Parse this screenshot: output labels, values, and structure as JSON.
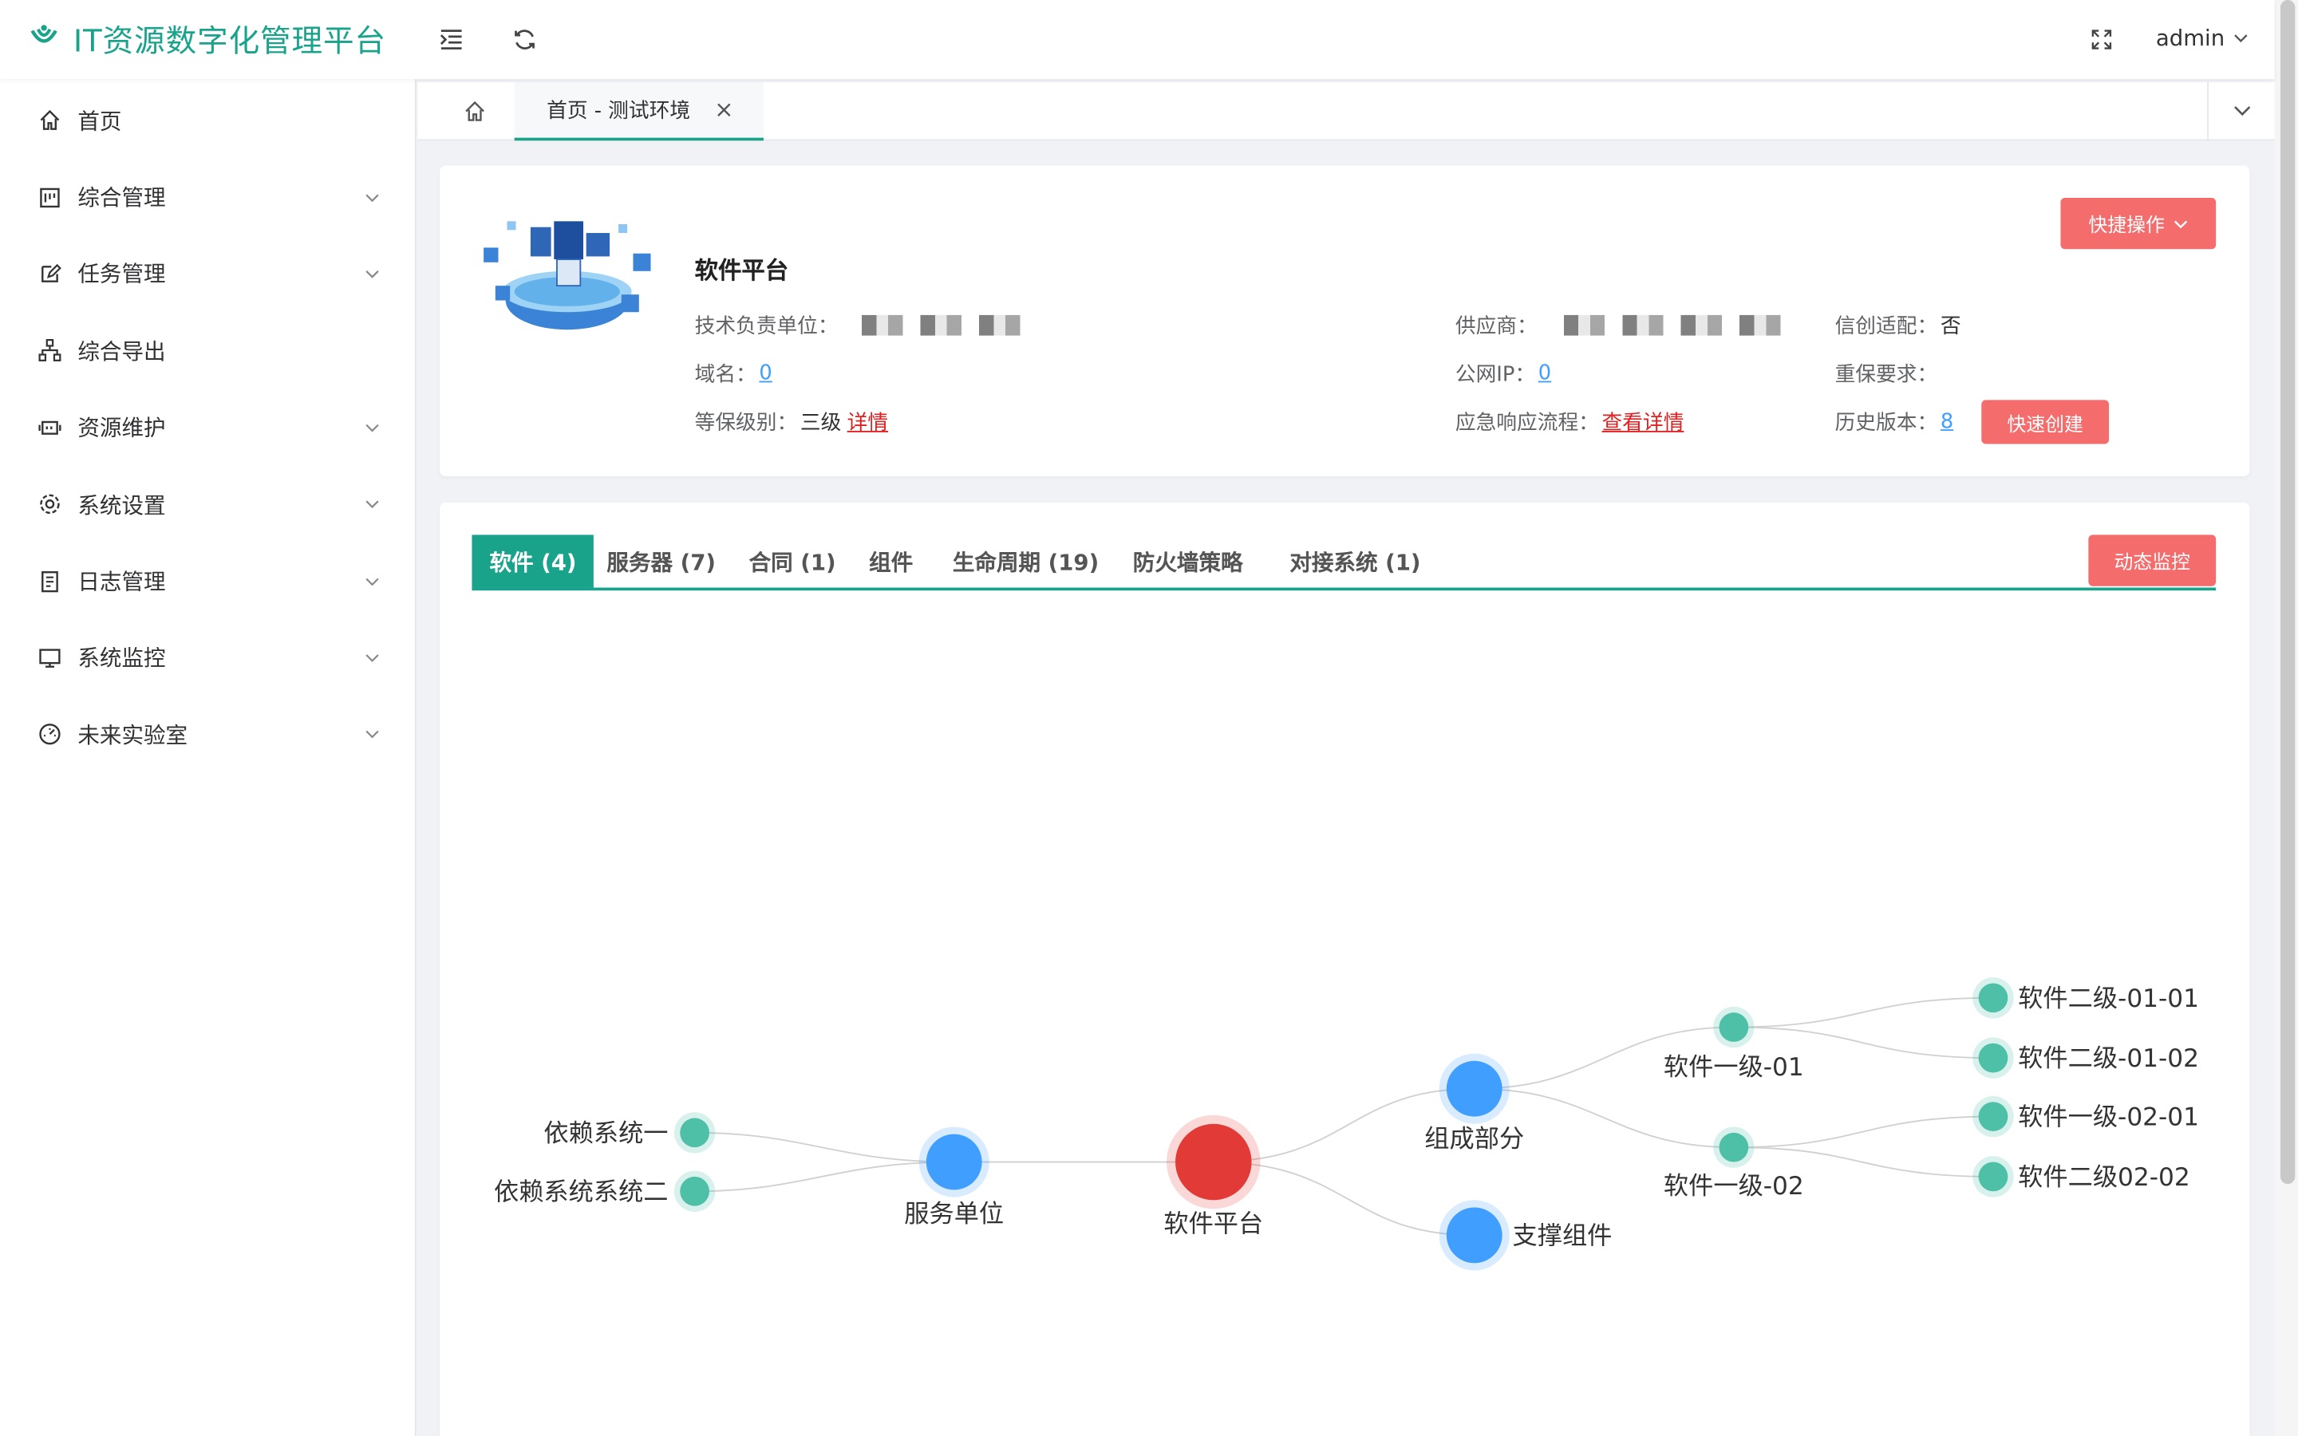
{
  "app": {
    "title": "IT资源数字化管理平台",
    "user": "admin",
    "brand_color": "#1aa38b",
    "accent_red": "#f56c6c"
  },
  "sidebar": {
    "items": [
      {
        "label": "首页",
        "icon": "home-icon",
        "expandable": false
      },
      {
        "label": "综合管理",
        "icon": "dashboard-icon",
        "expandable": true
      },
      {
        "label": "任务管理",
        "icon": "edit-icon",
        "expandable": true
      },
      {
        "label": "综合导出",
        "icon": "sitemap-icon",
        "expandable": false
      },
      {
        "label": "资源维护",
        "icon": "server-icon",
        "expandable": true
      },
      {
        "label": "系统设置",
        "icon": "gear-icon",
        "expandable": true
      },
      {
        "label": "日志管理",
        "icon": "document-icon",
        "expandable": true
      },
      {
        "label": "系统监控",
        "icon": "monitor-icon",
        "expandable": true
      },
      {
        "label": "未来实验室",
        "icon": "gauge-icon",
        "expandable": true
      }
    ]
  },
  "tabs": {
    "active_label": "首页 - 测试环境"
  },
  "info": {
    "name": "软件平台",
    "quick_ops": "快捷操作",
    "quick_create": "快速创建",
    "tech_unit_label": "技术负责单位：",
    "domain_label": "域名：",
    "domain_value": "0",
    "level_label": "等保级别：",
    "level_value": "三级",
    "level_link": "详情",
    "supplier_label": "供应商：",
    "public_ip_label": "公网IP：",
    "public_ip_value": "0",
    "emergency_label": "应急响应流程：",
    "emergency_link": "查看详情",
    "xinchuang_label": "信创适配：",
    "xinchuang_value": "否",
    "protect_label": "重保要求：",
    "history_label": "历史版本：",
    "history_value": "8"
  },
  "content_tabs": {
    "items": [
      "软件 (4)",
      "服务器 (7)",
      "合同 (1)",
      "组件",
      "生命周期 (19)",
      "防火墙策略",
      "对接系统 (1)"
    ],
    "active_index": 0,
    "monitor_button": "动态监控"
  },
  "graph": {
    "nodes": {
      "dep1": "依赖系统一",
      "dep2": "依赖系统系统二",
      "service": "服务单位",
      "center": "软件平台",
      "compose": "组成部分",
      "support": "支撑组件",
      "l1_01": "软件一级-01",
      "l1_02": "软件一级-02",
      "l2_0101": "软件二级-01-01",
      "l2_0102": "软件二级-01-02",
      "l2_0201": "软件一级-02-01",
      "l2_0202": "软件二级02-02"
    },
    "colors": {
      "center": "#e23a36",
      "blue": "#409eff",
      "green": "#4fc0a8"
    }
  }
}
